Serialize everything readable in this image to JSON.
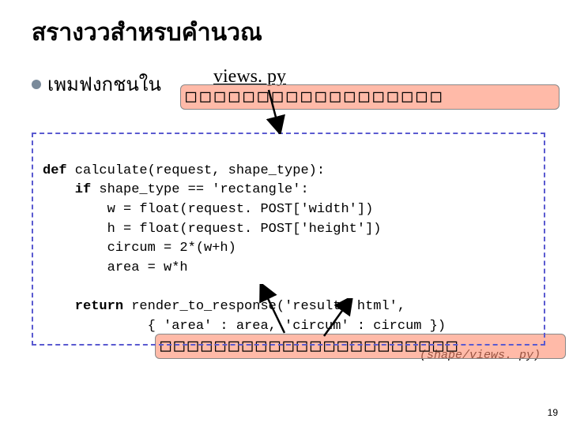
{
  "title": "สรางววสำหรบคำนวณ",
  "bullet": "เพมฟงกชนใน",
  "views_label": "views. py",
  "box_chars_top": "□□□□□□□□□□□□□□□□□□",
  "box_chars_bottom": "□□□□□□□□□□□□□□□□□□□□□□",
  "code": {
    "l1a": "def",
    "l1b": " calculate(request, shape_type):",
    "l2a": "    if",
    "l2b": " shape_type == 'rectangle':",
    "l3": "        w = float(request. POST['width'])",
    "l4": "        h = float(request. POST['height'])",
    "l5": "        circum = 2*(w+h)",
    "l6": "        area = w*h",
    "l7": "",
    "l8a": "    return",
    "l8b": " render_to_response('result. html',",
    "l9": "             { 'area' : area, 'circum' : circum })"
  },
  "file_path": "(shape/views. py)",
  "page_number": "19"
}
